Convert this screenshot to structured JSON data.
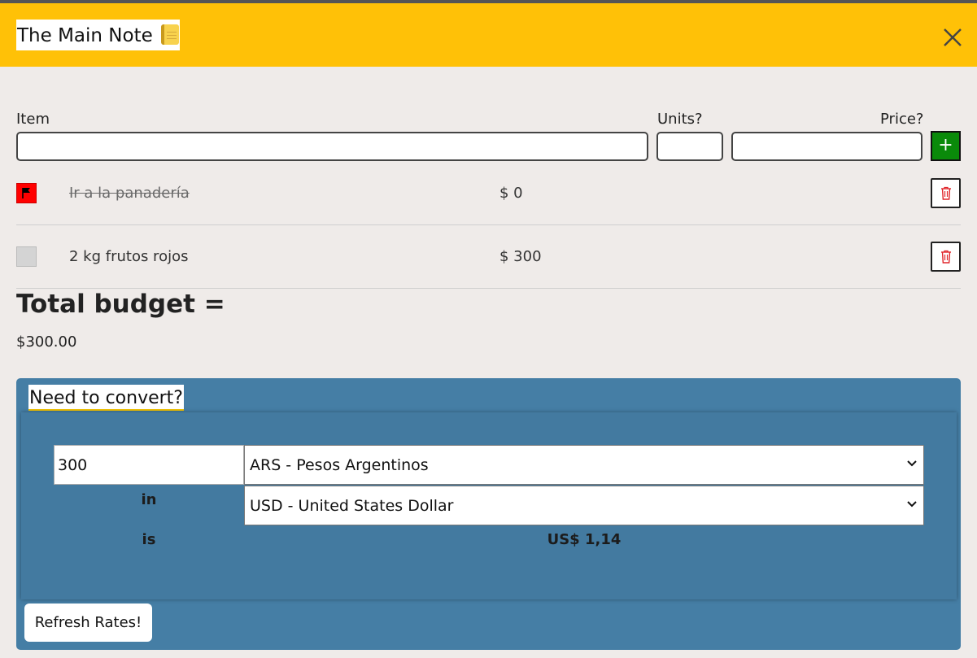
{
  "header": {
    "title": "The Main Note",
    "icon": "notebook-icon",
    "close_icon": "close-icon",
    "background_color": "#ffc107"
  },
  "form": {
    "item_label": "Item",
    "units_label": "Units?",
    "price_label": "Price?",
    "item_value": "",
    "units_value": "",
    "price_value": "",
    "add_label": "+",
    "add_color": "#0a8a0a"
  },
  "items": [
    {
      "text": "Ir a la panadería",
      "price": "$ 0",
      "done": true,
      "flag_icon": "flag-icon",
      "delete_icon": "trash-icon"
    },
    {
      "text": "2 kg frutos rojos",
      "price": "$ 300",
      "done": false,
      "delete_icon": "trash-icon"
    }
  ],
  "total": {
    "label": "Total budget =",
    "value": "$300.00"
  },
  "converter": {
    "title": "Need to convert?",
    "amount": "300",
    "from_currency": "ARS - Pesos Argentinos",
    "in_label": "in",
    "to_currency": "USD - United States Dollar",
    "is_label": "is",
    "result": "US$ 1,14",
    "refresh_label": "Refresh Rates!",
    "background_color": "#457ea5"
  }
}
